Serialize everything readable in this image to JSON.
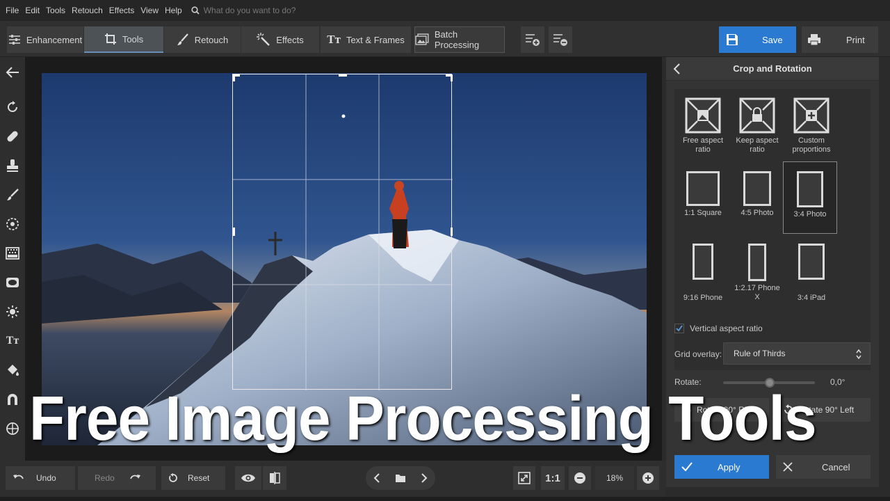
{
  "menu": {
    "items": [
      "File",
      "Edit",
      "Tools",
      "Retouch",
      "Effects",
      "View",
      "Help"
    ],
    "search_placeholder": "What do you want to do?"
  },
  "toolbar": {
    "tabs": [
      "Enhancement",
      "Tools",
      "Retouch",
      "Effects",
      "Text & Frames",
      "Batch Processing"
    ],
    "active_tab": "Tools",
    "save_label": "Save",
    "print_label": "Print",
    "accent": "#2a7ad2"
  },
  "left_tools": [
    "back-arrow-icon",
    "rotate-icon",
    "healing-icon",
    "stamp-icon",
    "brush-icon",
    "radial-icon",
    "gradient-icon",
    "vignette-icon",
    "light-icon",
    "text-icon",
    "fill-icon",
    "magnet-icon",
    "globe-icon"
  ],
  "panel": {
    "title": "Crop and Rotation",
    "ratios": [
      {
        "label": "Free aspect ratio"
      },
      {
        "label": "Keep aspect ratio"
      },
      {
        "label": "Custom proportions"
      },
      {
        "label": "1:1 Square"
      },
      {
        "label": "4:5 Photo"
      },
      {
        "label": "3:4 Photo"
      },
      {
        "label": "9:16 Phone"
      },
      {
        "label": "1:2.17 Phone X"
      },
      {
        "label": "3:4 iPad"
      }
    ],
    "selected_ratio": "3:4 Photo",
    "vertical_label": "Vertical aspect ratio",
    "vertical_checked": true,
    "grid_label": "Grid overlay:",
    "grid_value": "Rule of Thirds",
    "rotate_label": "Rotate:",
    "rotate_value": "0,0°",
    "rotate_right_label": "Rotate 90° Right",
    "rotate_left_label": "Rotate 90° Left",
    "apply_label": "Apply",
    "cancel_label": "Cancel"
  },
  "bottom": {
    "undo": "Undo",
    "redo": "Redo",
    "reset": "Reset",
    "zoom_1to1": "1:1",
    "zoom_value": "18%"
  },
  "overlay_title": "Free Image Processing Tools"
}
